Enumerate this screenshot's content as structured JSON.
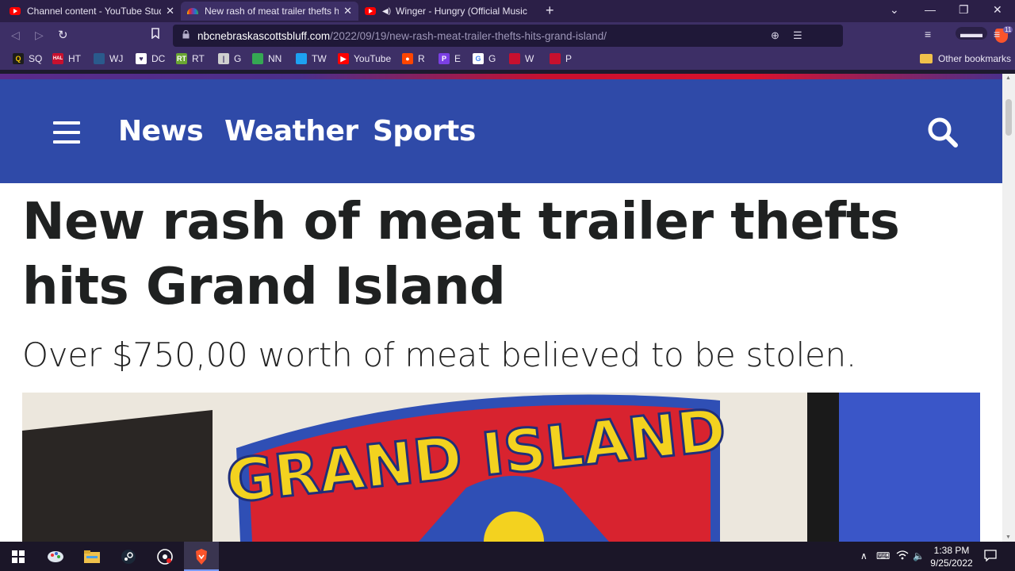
{
  "browser": {
    "tabs": [
      {
        "title": "Channel content - YouTube Studio",
        "favicon": "youtube-icon",
        "active": false
      },
      {
        "title": "New rash of meat trailer thefts hits Grand Island",
        "favicon": "nbc-peacock-icon",
        "active": true
      },
      {
        "title": "Winger - Hungry (Official Music Video)",
        "favicon": "youtube-icon",
        "active": false,
        "audio": true
      }
    ],
    "new_tab": "+",
    "url_host": "nbcnebraskascottsbluff.com",
    "url_path": "/2022/09/19/new-rash-meat-trailer-thefts-hits-grand-island/",
    "shield_count": "11",
    "bookmarks": [
      {
        "label": "SQ",
        "icon": "q-icon",
        "color": "#1d1d1d",
        "glyph": "Q",
        "glyph_color": "#f3c400"
      },
      {
        "label": "HT",
        "icon": "hal-icon",
        "color": "#c8102e",
        "glyph": "HAL",
        "glyph_color": "#ffffff"
      },
      {
        "label": "WJ",
        "icon": "wj-icon",
        "color": "#2a5a8c",
        "glyph": "",
        "glyph_color": "#ffffff"
      },
      {
        "label": "DC",
        "icon": "heart-shield-icon",
        "color": "#ffffff",
        "glyph": "♥",
        "glyph_color": "#3d2f66"
      },
      {
        "label": "RT",
        "icon": "rt-icon",
        "color": "#6aa632",
        "glyph": "RT",
        "glyph_color": "#ffffff"
      },
      {
        "label": "G",
        "icon": "g-bar-icon",
        "color": "#cfcfcf",
        "glyph": "|",
        "glyph_color": "#3d2f66"
      },
      {
        "label": "NN",
        "icon": "leaf-icon",
        "color": "#35a853",
        "glyph": "",
        "glyph_color": "#ffffff"
      },
      {
        "label": "TW",
        "icon": "twitter-icon",
        "color": "#1da1f2",
        "glyph": "",
        "glyph_color": "#ffffff"
      },
      {
        "label": "YouTube",
        "icon": "youtube-icon",
        "color": "#ff0000",
        "glyph": "▶",
        "glyph_color": "#ffffff"
      },
      {
        "label": "R",
        "icon": "reddit-icon",
        "color": "#ff4500",
        "glyph": "●",
        "glyph_color": "#ffffff"
      },
      {
        "label": "E",
        "icon": "p-logo-icon",
        "color": "#7b3fe4",
        "glyph": "P",
        "glyph_color": "#ffffff"
      },
      {
        "label": "G",
        "icon": "google-icon",
        "color": "#ffffff",
        "glyph": "G",
        "glyph_color": "#4285f4"
      },
      {
        "label": "W",
        "icon": "stripe-icon",
        "color": "#c8102e",
        "glyph": "",
        "glyph_color": "#ffffff"
      },
      {
        "label": "P",
        "icon": "stripe-icon",
        "color": "#c8102e",
        "glyph": "",
        "glyph_color": "#ffffff"
      }
    ],
    "other_bookmarks": "Other bookmarks"
  },
  "site": {
    "nav": {
      "news": "News",
      "weather": "Weather",
      "sports": "Sports"
    },
    "brand_colors": {
      "bar": "#2f4aa8",
      "accent_red": "#c8102e"
    }
  },
  "article": {
    "headline": "New rash of meat trailer thefts hits Grand Island",
    "subheadline": "Over $750,00 worth of meat believed to be stolen.",
    "image_text": "GRAND ISLAND"
  },
  "taskbar": {
    "time": "1:38 PM",
    "date": "9/25/2022"
  }
}
